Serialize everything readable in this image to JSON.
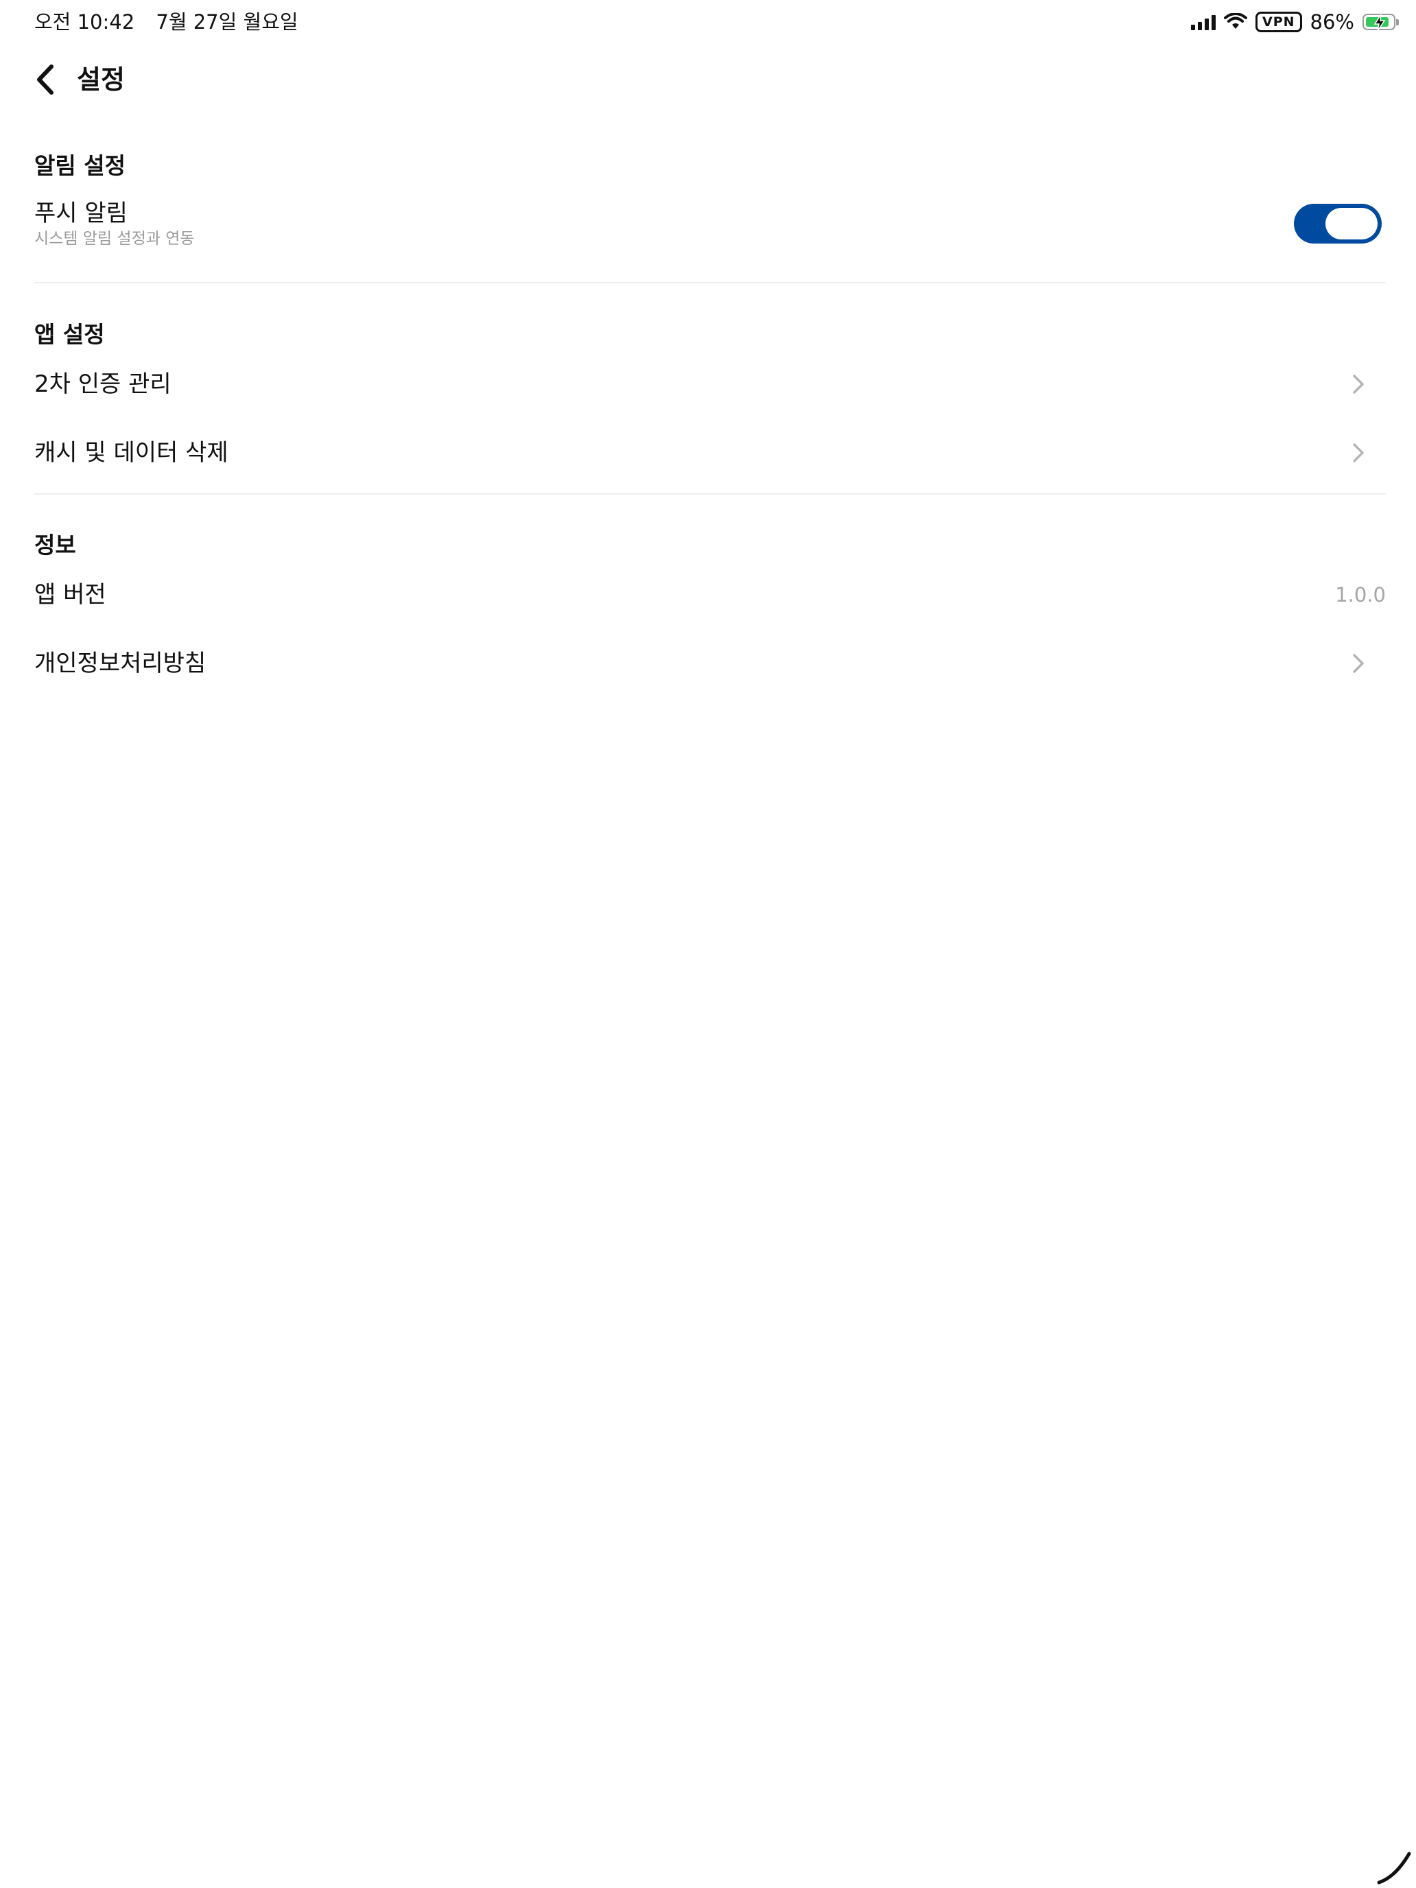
{
  "status_bar": {
    "time": "오전 10:42",
    "date": "7월 27일 월요일",
    "vpn": "VPN",
    "battery": "86%",
    "battery_level": 0.86,
    "icons": [
      "signal-icon",
      "wifi-icon",
      "vpn-badge",
      "battery-charging-icon"
    ]
  },
  "header": {
    "back_icon": "chevron-left-icon",
    "title": "설정"
  },
  "sections": {
    "notifications": {
      "title": "알림 설정",
      "push": {
        "label": "푸시 알림",
        "sublabel": "시스템 알림 설정과 연동",
        "enabled": true
      }
    },
    "app": {
      "title": "앱 설정",
      "items": [
        {
          "label": "2차 인증 관리"
        },
        {
          "label": "캐시 및 데이터 삭제"
        }
      ]
    },
    "info": {
      "title": "정보",
      "version_label": "앱 버전",
      "version_value": "1.0.0",
      "privacy_label": "개인정보처리방침"
    }
  },
  "colors": {
    "accent": "#004aa0",
    "text": "#111111",
    "muted": "#9b9b9b",
    "divider": "#eeeeee",
    "chevron": "#b5b5b5",
    "battery_fill": "#34c759"
  }
}
